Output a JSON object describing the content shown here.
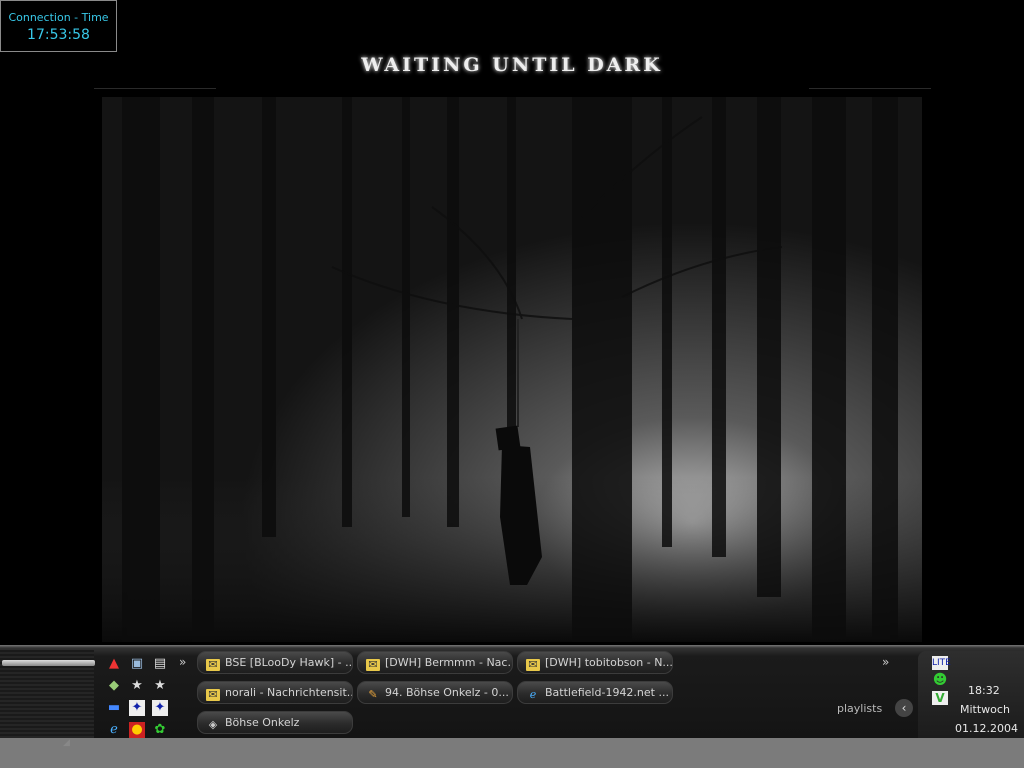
{
  "connection": {
    "label": "Connection - Time",
    "time": "17:53:58"
  },
  "desktop": {
    "title": "WAITING UNTIL DARK"
  },
  "quick_launch": {
    "icons": [
      "acrobat-icon",
      "monitor-icon",
      "document-icon",
      "money-icon",
      "star-icon",
      "star-icon",
      "arena-icon",
      "counter-strike-icon",
      "counter-strike-icon",
      "ie-icon",
      "hawk-icon",
      "icq-lite-icon"
    ]
  },
  "taskbar": {
    "buttons": [
      {
        "label": "BSE [BLooDy Hawk] - ...",
        "icon": "folder"
      },
      {
        "label": "[DWH] Bermmm - Nac...",
        "icon": "folder"
      },
      {
        "label": "[DWH] tobitobson - N...",
        "icon": "folder"
      },
      {
        "label": "norali - Nachrichtensit...",
        "icon": "folder"
      },
      {
        "label": "94. Böhse Onkelz - 0...",
        "icon": "pen"
      },
      {
        "label": "Battlefield-1942.net ...",
        "icon": "ie"
      },
      {
        "label": "Böhse Onkelz",
        "icon": "note"
      }
    ],
    "playlists_label": "playlists"
  },
  "tray": {
    "time": "18:32",
    "day": "Mittwoch",
    "date": "01.12.2004"
  }
}
